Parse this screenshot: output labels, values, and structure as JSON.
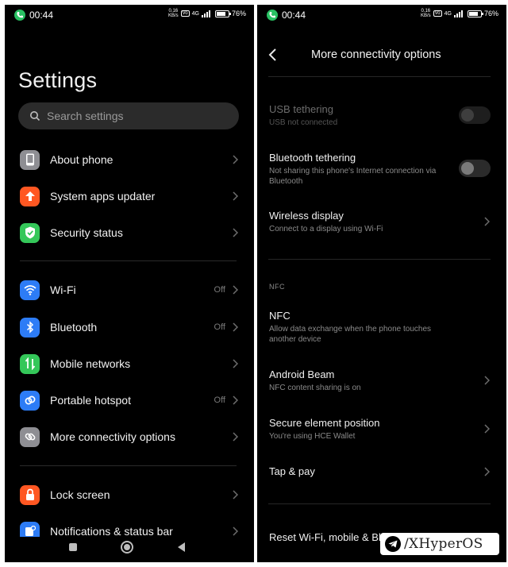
{
  "status_bar": {
    "time": "00:44",
    "net_speed_value": "0.16",
    "net_speed_unit": "KB/s",
    "chip": "VoLTE",
    "network": "4G",
    "battery": "76%"
  },
  "left": {
    "title": "Settings",
    "search_placeholder": "Search settings",
    "items": [
      {
        "label": "About phone",
        "icon": "phone-icon",
        "color": "#8e8e93"
      },
      {
        "label": "System apps updater",
        "icon": "arrow-up-icon",
        "color": "#ff5722"
      },
      {
        "label": "Security status",
        "icon": "shield-check-icon",
        "color": "#34c759"
      },
      {
        "label": "Wi-Fi",
        "value": "Off",
        "icon": "wifi-icon",
        "color": "#2d7cf6"
      },
      {
        "label": "Bluetooth",
        "value": "Off",
        "icon": "bluetooth-icon",
        "color": "#2d7cf6"
      },
      {
        "label": "Mobile networks",
        "icon": "mobile-data-icon",
        "color": "#34c759"
      },
      {
        "label": "Portable hotspot",
        "value": "Off",
        "icon": "hotspot-icon",
        "color": "#2d7cf6"
      },
      {
        "label": "More connectivity options",
        "icon": "link-icon",
        "color": "#8e8e93"
      },
      {
        "label": "Lock screen",
        "icon": "lock-icon",
        "color": "#ff5722"
      },
      {
        "label": "Notifications & status bar",
        "icon": "notification-icon",
        "color": "#2d7cf6"
      }
    ]
  },
  "right": {
    "title": "More connectivity options",
    "options": [
      {
        "title": "USB tethering",
        "subtitle": "USB not connected"
      },
      {
        "title": "Bluetooth tethering",
        "subtitle": "Not sharing this phone's Internet connection via Bluetooth"
      },
      {
        "title": "Wireless display",
        "subtitle": "Connect to a display using Wi-Fi"
      },
      {
        "title": "NFC",
        "subtitle": "Allow data exchange when the phone touches another device"
      },
      {
        "title": "Android Beam",
        "subtitle": "NFC content sharing is on"
      },
      {
        "title": "Secure element position",
        "subtitle": "You're using HCE Wallet"
      },
      {
        "title": "Tap & pay"
      },
      {
        "title": "Reset Wi-Fi, mobile & Bluetooth"
      }
    ],
    "section_nfc": "NFC"
  },
  "watermark": {
    "text": "/XHyperOS"
  }
}
